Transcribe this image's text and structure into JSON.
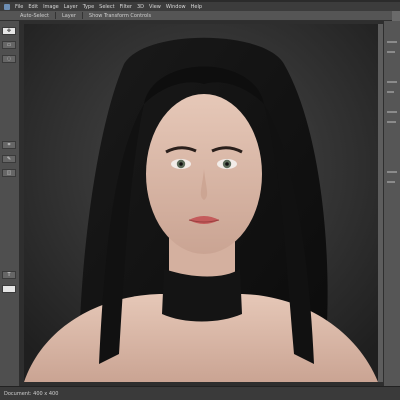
{
  "menubar": {
    "items": [
      "File",
      "Edit",
      "Image",
      "Layer",
      "Type",
      "Select",
      "Filter",
      "3D",
      "View",
      "Window",
      "Help"
    ]
  },
  "optionsbar": {
    "items": [
      "Auto-Select",
      "Layer",
      "Show Transform Controls"
    ]
  },
  "toolbar": {
    "tools": [
      "move-tool",
      "marquee-tool",
      "lasso-tool",
      "crop-tool",
      "brush-tool",
      "eraser-tool",
      "text-tool"
    ],
    "active_tool": "move-tool"
  },
  "canvas": {
    "subject": "portrait"
  },
  "statusbar": {
    "text": "Document: 400 x 400"
  },
  "colors": {
    "ui_dark": "#2e2e2e",
    "ui_mid": "#4f4f4f",
    "ui_light": "#d8d8d8"
  }
}
